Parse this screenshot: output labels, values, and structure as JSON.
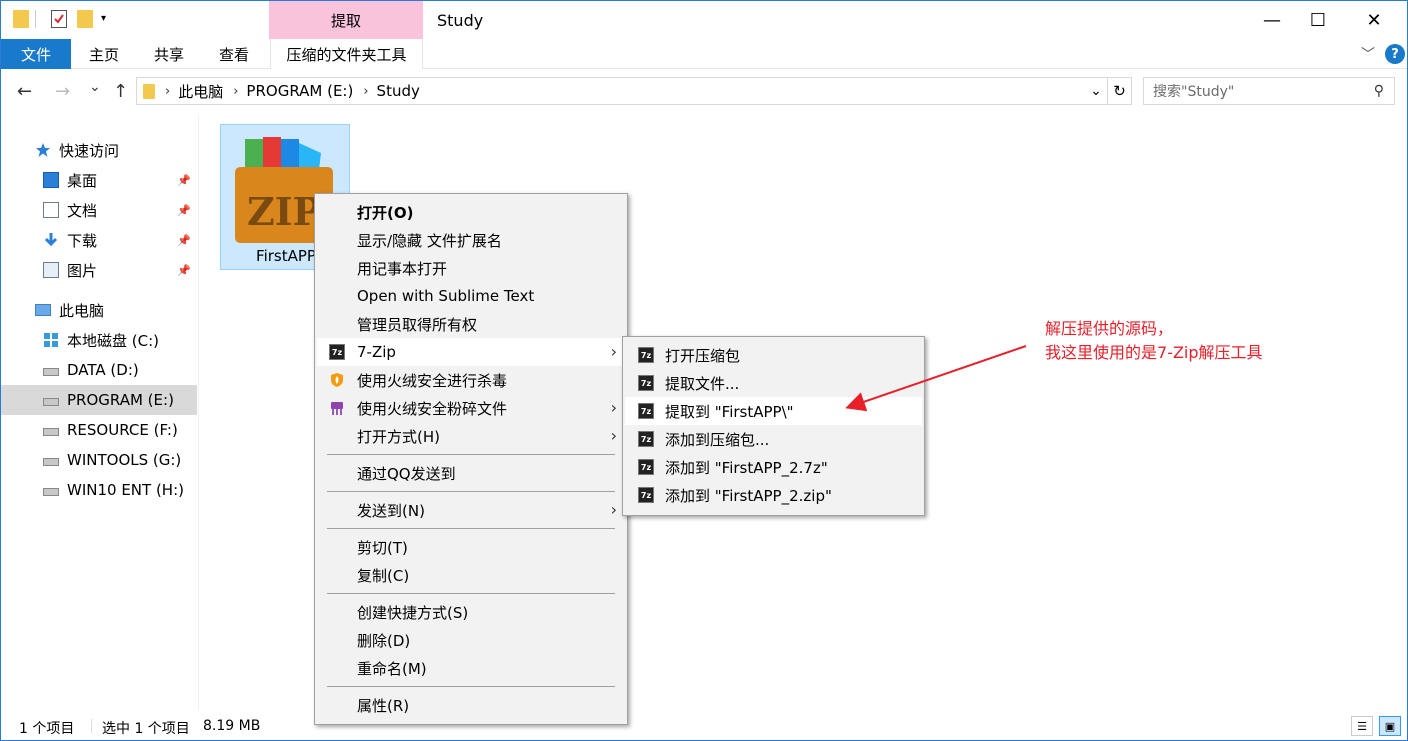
{
  "window": {
    "context_tab": "提取",
    "title": "Study",
    "minimize_glyph": "—",
    "maximize_glyph": "☐",
    "close_glyph": "✕"
  },
  "ribbon": {
    "tabs": [
      "文件",
      "主页",
      "共享",
      "查看",
      "压缩的文件夹工具"
    ],
    "expand_glyph": "﹀",
    "help_glyph": "?"
  },
  "address": {
    "back_glyph": "←",
    "forward_glyph": "→",
    "recent_glyph": "⌄",
    "up_glyph": "↑",
    "crumbs": [
      "此电脑",
      "PROGRAM (E:)",
      "Study"
    ],
    "crumb_sep": "›",
    "dropdown_glyph": "⌄",
    "refresh_glyph": "↻",
    "search_placeholder": "搜索\"Study\"",
    "search_glyph": "⚲"
  },
  "sidebar": {
    "quick_access": "快速访问",
    "pinned": [
      "桌面",
      "文档",
      "下载",
      "图片"
    ],
    "pin_glyph": "📌",
    "this_pc": "此电脑",
    "drives": [
      "本地磁盘 (C:)",
      "DATA (D:)",
      "PROGRAM (E:)",
      "RESOURCE (F:)",
      "WINTOOLS (G:)",
      "WIN10 ENT (H:)"
    ],
    "selected_drive": "PROGRAM (E:)"
  },
  "content": {
    "file_name": "FirstAPP",
    "zip_text": "ZIP"
  },
  "status": {
    "count": "1 个项目",
    "selection": "选中 1 个项目",
    "size": "8.19 MB"
  },
  "context_menu": {
    "items": {
      "open": "打开(O)",
      "show_hide_ext": "显示/隐藏 文件扩展名",
      "notepad": "用记事本打开",
      "sublime": "Open with Sublime Text",
      "take_ownership": "管理员取得所有权",
      "sevenzip": "7-Zip",
      "huorong_scan": "使用火绒安全进行杀毒",
      "huorong_shred": "使用火绒安全粉碎文件",
      "open_with": "打开方式(H)",
      "qq_send": "通过QQ发送到",
      "send_to": "发送到(N)",
      "cut": "剪切(T)",
      "copy": "复制(C)",
      "create_shortcut": "创建快捷方式(S)",
      "delete": "删除(D)",
      "rename": "重命名(M)",
      "properties": "属性(R)"
    },
    "submenu_arrow": "›",
    "sevenzip_icon_text": "7z"
  },
  "submenu": {
    "items": [
      "打开压缩包",
      "提取文件...",
      "提取到 \"FirstAPP\\\"",
      "添加到压缩包...",
      "添加到 \"FirstAPP_2.7z\"",
      "添加到 \"FirstAPP_2.zip\""
    ]
  },
  "annotation": {
    "line1": "解压提供的源码，",
    "line2": "我这里使用的是7-Zip解压工具",
    "color": "#e8202a"
  },
  "colors": {
    "accent": "#1979ca",
    "context_tab_pink": "#f9c3dc",
    "selection_bg": "#cce8ff"
  }
}
